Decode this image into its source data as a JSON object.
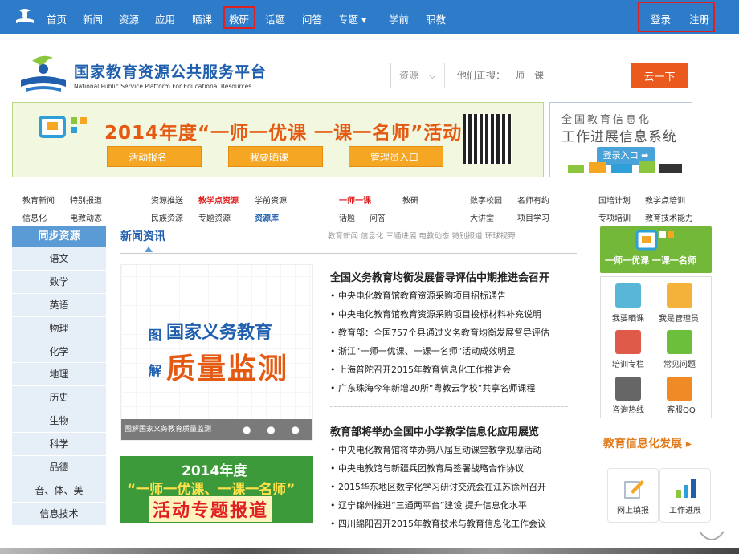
{
  "topnav": {
    "items": [
      "首页",
      "新闻",
      "资源",
      "应用",
      "晒课",
      "教研",
      "话题",
      "问答",
      "专题 ▾",
      "学前",
      "职教"
    ],
    "login": "登录",
    "register": "注册"
  },
  "site": {
    "name": "国家教育资源公共服务平台",
    "name_en": "National Public Service Platform For Educational Resources"
  },
  "search": {
    "category": "资源",
    "placeholder": "他们正搜：一师一课",
    "button": "云一下"
  },
  "banner": {
    "title": "2014年度“一师一优课 一课一名师”活动",
    "buttons": [
      "活动报名",
      "我要晒课",
      "管理员入口"
    ]
  },
  "infosys": {
    "line1": "全国教育信息化",
    "line2": "工作进展信息系统",
    "login": "登录入口 ➡"
  },
  "quicklinks": {
    "g1r1": [
      "教育新闻",
      "特别报道"
    ],
    "g1r2": [
      "信息化",
      "电教动态"
    ],
    "g2r1": [
      "资源推送",
      "教学点资源",
      "学前资源"
    ],
    "g2r2": [
      "民族资源",
      "专题资源",
      "资源库"
    ],
    "g3r1": [
      "一师一课",
      "教研"
    ],
    "g3r2": [
      "话题",
      "问答"
    ],
    "g4r1": [
      "数字校园",
      "名师有约"
    ],
    "g4r2": [
      "大讲堂",
      "项目学习"
    ],
    "g5r1": [
      "国培计划",
      "教学点培训"
    ],
    "g5r2": [
      "专项培训",
      "教育技术能力"
    ]
  },
  "sidebar": {
    "title": "同步资源",
    "items": [
      "语文",
      "数学",
      "英语",
      "物理",
      "化学",
      "地理",
      "历史",
      "生物",
      "科学",
      "品德",
      "音、体、美",
      "信息技术"
    ]
  },
  "news": {
    "heading": "新闻资讯",
    "tabs": "教育新闻  信息化  三通进展  电教动态  特别报道  环球视野",
    "featured": {
      "c1": "图",
      "c2": "国家义务教育",
      "c3": "解",
      "c4": "质量监测",
      "caption": "图解国家义务教育质量监测",
      "dots": "● ● ●"
    },
    "promo": {
      "p1": "2014年度",
      "p2": "“一师一优课、一课一名师”",
      "p3": "活动专题报道"
    },
    "block1": {
      "title": "全国义务教育均衡发展督导评估中期推进会召开",
      "items": [
        "中央电化教育馆教育资源采购项目招标通告",
        "中央电化教育馆教育资源采购项目投标材料补充说明",
        "教育部：全国757个县通过义务教育均衡发展督导评估",
        "浙江“一师一优课、一课一名师”活动成效明显",
        "上海普陀召开2015年教育信息化工作推进会",
        "广东珠海今年新增20所“粤教云学校”共享名师课程"
      ]
    },
    "block2": {
      "title": "教育部将举办全国中小学教学信息化应用展览",
      "items": [
        "中央电化教育馆将举办第八届互动课堂教学观摩活动",
        "中央电教馆与新疆兵团教育局签署战略合作协议",
        "2015华东地区数字化学习研讨交流会在江苏徐州召开",
        "辽宁锦州推进“三通两平台”建设 提升信息化水平",
        "四川绵阳召开2015年教育技术与教育信息化工作会议"
      ]
    }
  },
  "right": {
    "banner": "一师一优课 一课一名师",
    "icons": [
      "我要晒课",
      "我是管理员",
      "培训专栏",
      "常见问题",
      "咨询热线",
      "客服QQ"
    ],
    "edu_title": "教育信息化发展 ▸",
    "tiles": [
      "网上填报",
      "工作进展"
    ]
  },
  "colors": {
    "nav": "#2e7cc9",
    "accent": "#ea5a1e",
    "link": "#1f5fae"
  }
}
